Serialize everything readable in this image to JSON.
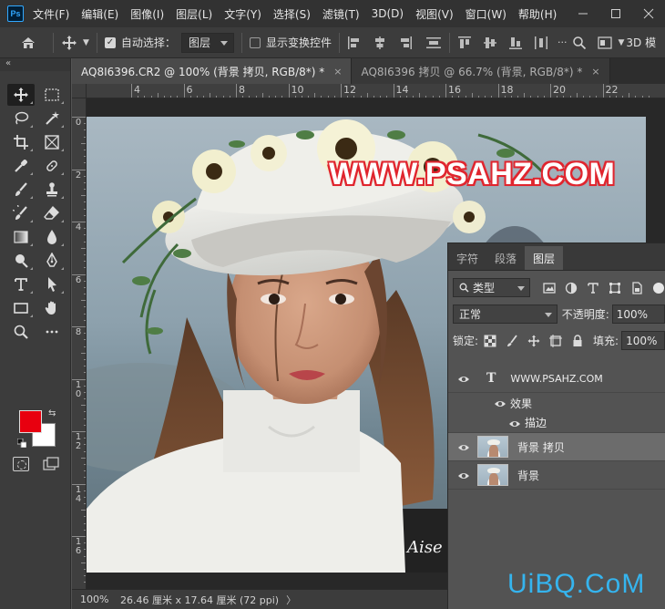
{
  "menubar": {
    "logo": "Ps",
    "items": [
      "文件(F)",
      "编辑(E)",
      "图像(I)",
      "图层(L)",
      "文字(Y)",
      "选择(S)",
      "滤镜(T)",
      "3D(D)",
      "视图(V)",
      "窗口(W)",
      "帮助(H)"
    ]
  },
  "options_bar": {
    "auto_select_label": "自动选择：",
    "auto_select_checked": true,
    "auto_select_target": "图层",
    "show_transform_label": "显示变换控件",
    "show_transform_checked": false,
    "mode_3d_label": "3D 模"
  },
  "tools": {
    "collapse_label": "«",
    "items": [
      "move-tool",
      "marquee-tool",
      "lasso-tool",
      "magic-wand-tool",
      "crop-tool",
      "frame-tool",
      "eyedropper-tool",
      "healing-brush-tool",
      "brush-tool",
      "clone-stamp-tool",
      "history-brush-tool",
      "eraser-tool",
      "gradient-tool",
      "blur-tool",
      "dodge-tool",
      "pen-tool",
      "type-tool",
      "path-selection-tool",
      "rectangle-tool",
      "hand-tool",
      "zoom-tool",
      "more-tools"
    ],
    "foreground_color": "#e8000f",
    "background_color": "#ffffff"
  },
  "document_tabs": [
    {
      "label": "AQ8I6396.CR2 @ 100% (背景 拷贝, RGB/8*) *",
      "close": "×",
      "active": true
    },
    {
      "label": "AQ8I6396 拷贝 @ 66.7% (背景, RGB/8*) *",
      "close": "×",
      "active": false
    }
  ],
  "rulers": {
    "top_labels": [
      "4",
      "6",
      "8",
      "10",
      "12",
      "14",
      "16",
      "18",
      "20",
      "22"
    ],
    "left_labels": [
      "0",
      "2",
      "4",
      "6",
      "8",
      "1\n0",
      "1\n2",
      "1\n4",
      "1\n6"
    ]
  },
  "canvas": {
    "watermark_text": "WWW.PSAHZ.COM",
    "watermark_fill": "#ffffff",
    "watermark_stroke": "#e0262f"
  },
  "statusbar": {
    "zoom": "100%",
    "doc_size": "26.46 厘米 x 17.64 厘米 (72 ppi)",
    "arrow": "〉"
  },
  "layers_panel": {
    "tabs": [
      {
        "label": "字符",
        "active": false
      },
      {
        "label": "段落",
        "active": false
      },
      {
        "label": "图层",
        "active": true
      }
    ],
    "filter_kind": "类型",
    "blend_mode": "正常",
    "opacity_label": "不透明度:",
    "opacity_value": "100%",
    "lock_label": "锁定:",
    "fill_label": "填充:",
    "fill_value": "100%",
    "layers": [
      {
        "name": "WWW.PSAHZ.COM",
        "type": "text",
        "icon": "T",
        "selected": false
      },
      {
        "name": "效果",
        "type": "effects",
        "selected": false
      },
      {
        "name": "描边",
        "type": "effect-item",
        "selected": false
      },
      {
        "name": "背景 拷贝",
        "type": "image",
        "selected": true
      },
      {
        "name": "背景",
        "type": "image",
        "selected": false
      }
    ]
  },
  "site_watermark": "UiBQ.CoM",
  "colors": {
    "accent_blue": "#31a8ff",
    "site_mark": "#35b4ee",
    "panel_bg": "#535353",
    "menubar_bg": "#323232"
  }
}
